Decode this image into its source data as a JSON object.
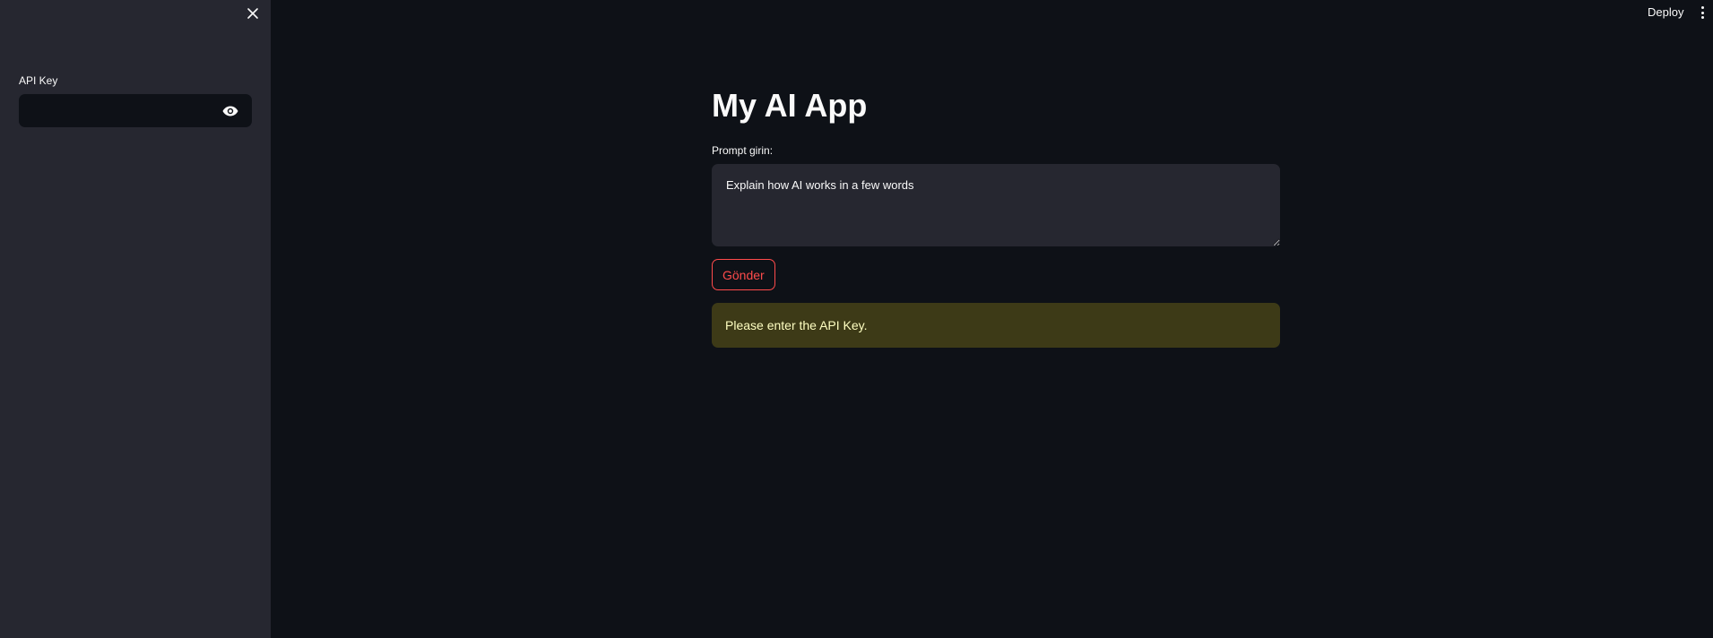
{
  "sidebar": {
    "api_key_label": "API Key",
    "api_key_value": ""
  },
  "header": {
    "deploy_label": "Deploy"
  },
  "main": {
    "title": "My AI App",
    "prompt_label": "Prompt girin:",
    "prompt_value": "Explain how AI works in a few words",
    "send_label": "Gönder",
    "warning_text": "Please enter the API Key."
  },
  "colors": {
    "background": "#0e1117",
    "sidebar": "#262730",
    "accent": "#ff4b4b",
    "warning_bg": "#3d3a17",
    "warning_text": "#ffffc2"
  },
  "icons": [
    "close-icon",
    "eye-icon",
    "more-vertical-icon"
  ]
}
